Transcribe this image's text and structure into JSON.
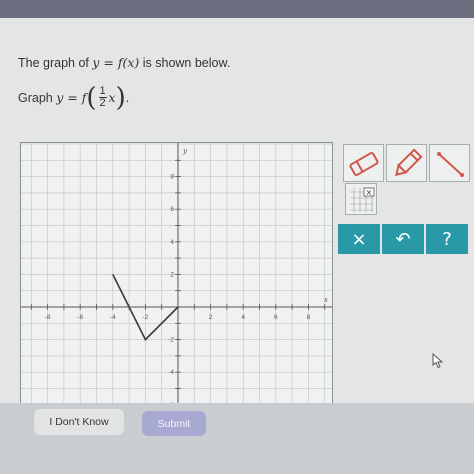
{
  "question": {
    "line1_prefix": "The graph of ",
    "line1_func": "y = f(x)",
    "line1_suffix": " is shown below.",
    "line2_prefix": "Graph ",
    "line2_func": "y = f",
    "frac_num": "1",
    "frac_den": "2",
    "line2_var": "x",
    "line2_suffix": "."
  },
  "graph": {
    "x_label": "x",
    "y_label": "y",
    "x_ticks": [
      "-8",
      "-6",
      "-4",
      "-2",
      "2",
      "4",
      "6",
      "8"
    ],
    "y_ticks": [
      "8",
      "6",
      "4",
      "2",
      "-2",
      "-4",
      "-6"
    ],
    "x_range": [
      -9,
      9
    ],
    "y_range": [
      -6,
      9
    ],
    "polyline": [
      [
        -4,
        2
      ],
      [
        -2,
        -2
      ],
      [
        0,
        0
      ]
    ],
    "line_color": "#3a3a3a"
  },
  "tools": {
    "eraser": "eraser-icon",
    "pencil": "pencil-icon",
    "segment": "line-segment-icon",
    "grid": "grid-icon",
    "accent_color": "#2a99a7",
    "clear_label": "×",
    "undo_label": "↶",
    "help_label": "?"
  },
  "buttons": {
    "dont_know": "I Don't Know",
    "submit": "Submit"
  }
}
